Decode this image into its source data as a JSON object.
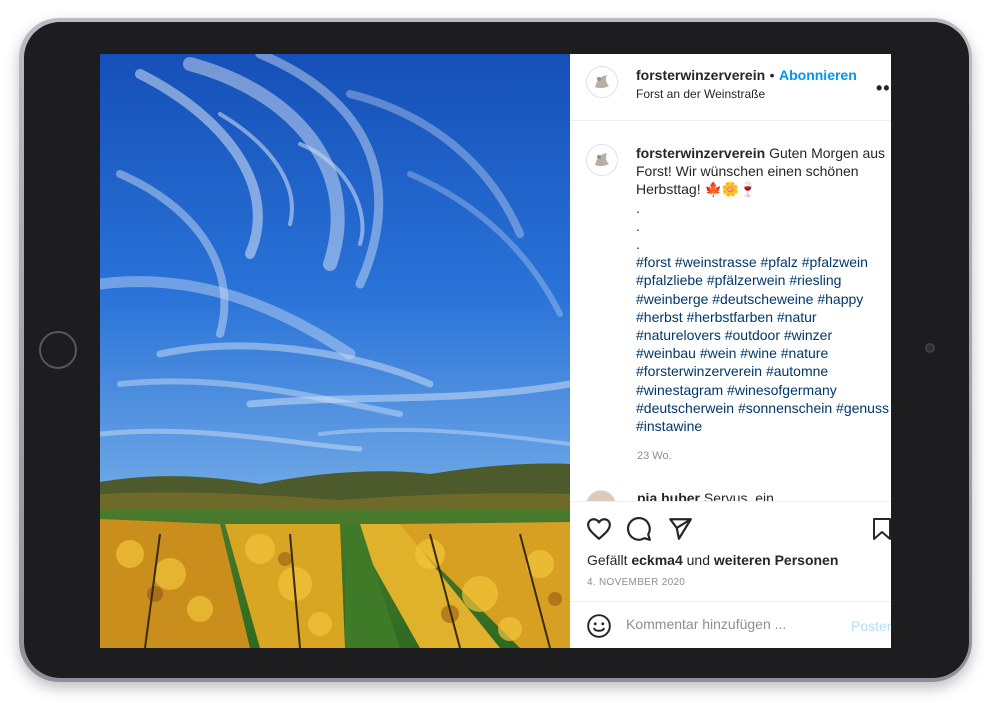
{
  "post": {
    "username": "forsterwinzerverein",
    "follow_separator": "•",
    "follow_label": "Abonnieren",
    "location": "Forst an der Weinstraße",
    "more_icon": "more-options-icon",
    "caption_text": "Guten Morgen aus Forst! Wir wünschen einen schönen Herbsttag! 🍁🌼🍷",
    "caption_dots": [
      ".",
      ".",
      "."
    ],
    "hashtags": "#forst #weinstrasse #pfalz #pfalzwein #pfalzliebe #pfälzerwein #riesling #weinberge #deutscheweine #happy #herbst #herbstfarben #natur #naturelovers #outdoor #winzer #weinbau #wein #wine #nature #forsterwinzerverein #automne #winestagram #winesofgermany #deutscherwein #sonnenschein #genuss #instawine",
    "time_ago": "23 Wo.",
    "comment_preview_user": "pia.huber",
    "comment_preview_text": "Servus, ein",
    "likes_prefix": "Gefällt",
    "likes_user": "eckma4",
    "likes_and": "und",
    "likes_suffix": "weiteren Personen",
    "date": "4. NOVEMBER 2020",
    "comment_placeholder": "Kommentar hinzufügen ...",
    "post_button": "Posten"
  },
  "icons": [
    "heart-icon",
    "comment-icon",
    "share-icon",
    "bookmark-icon",
    "emoji-icon"
  ],
  "colors": {
    "link_blue": "#0095f6",
    "hashtag_blue": "#00376b",
    "text": "#262626",
    "muted": "#8e8e8e"
  }
}
